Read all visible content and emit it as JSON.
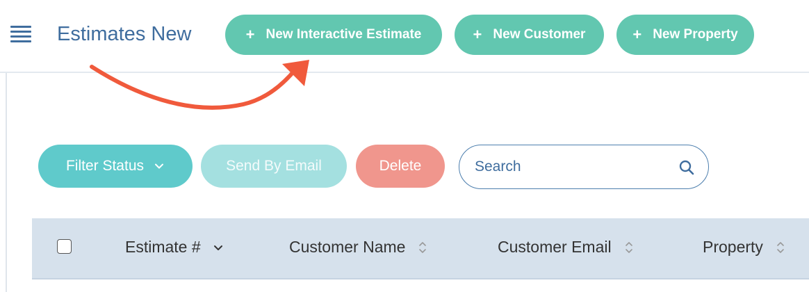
{
  "header": {
    "title": "Estimates New",
    "actions": [
      {
        "label": "New Interactive Estimate",
        "icon": "plus-icon"
      },
      {
        "label": "New Customer",
        "icon": "plus-icon"
      },
      {
        "label": "New Property",
        "icon": "plus-icon"
      }
    ]
  },
  "toolbar": {
    "filter_label": "Filter Status",
    "send_email_label": "Send By Email",
    "delete_label": "Delete",
    "search_placeholder": "Search"
  },
  "table": {
    "columns": [
      {
        "label": "Estimate #",
        "sort": "desc"
      },
      {
        "label": "Customer Name",
        "sort": "none"
      },
      {
        "label": "Customer Email",
        "sort": "none"
      },
      {
        "label": "Property",
        "sort": "none"
      }
    ]
  },
  "colors": {
    "brand_blue": "#3f6d9e",
    "action_green": "#62c7b0",
    "filter_teal": "#5fcacb",
    "disabled_teal": "#a4e0e0",
    "delete_red": "#f0968d",
    "table_header_bg": "#d6e1ec",
    "annotation_arrow": "#f05a3c"
  }
}
